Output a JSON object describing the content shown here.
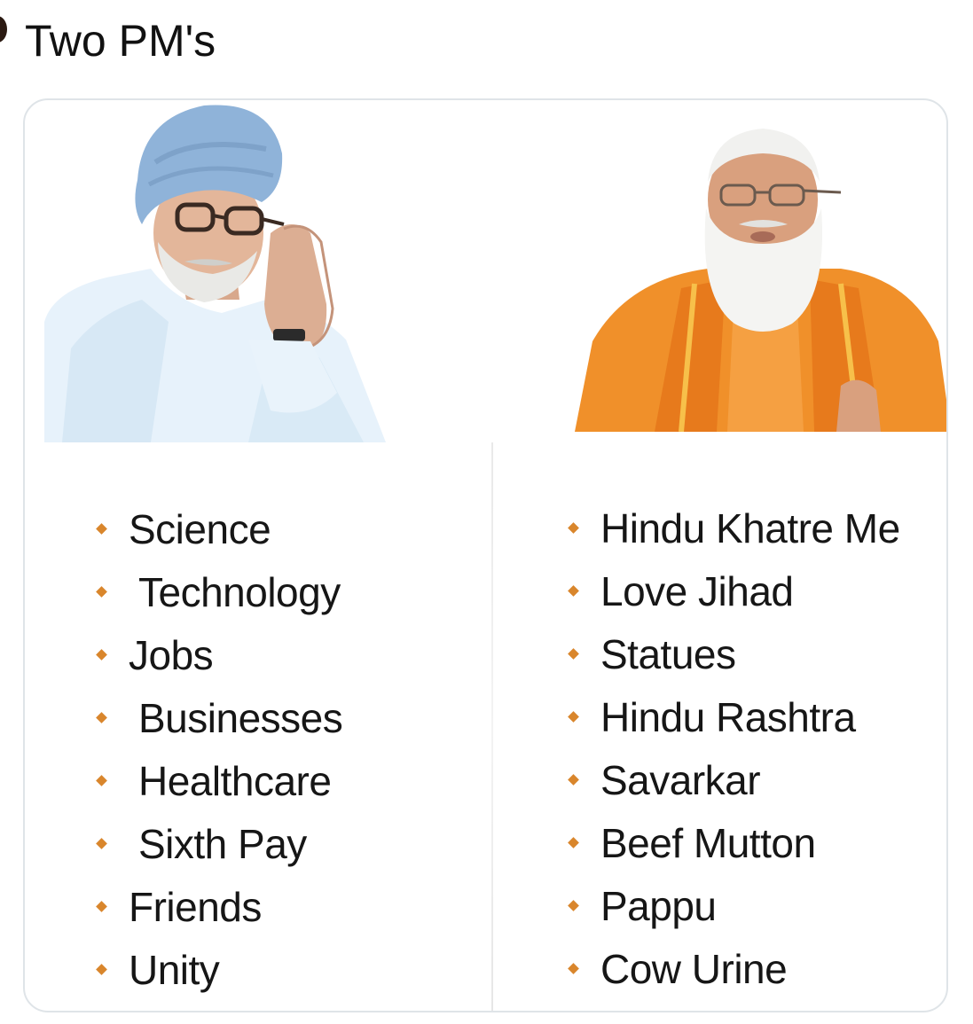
{
  "tweet": {
    "text": "Two PM's"
  },
  "colors": {
    "bullet": "#d9862c",
    "card_border": "#dfe4e8",
    "turban": "#8fb3d9",
    "saffron": "#f0902a"
  },
  "left_column": {
    "items": [
      {
        "label": "Science",
        "indent": false
      },
      {
        "label": "Technology",
        "indent": true
      },
      {
        "label": "Jobs",
        "indent": false
      },
      {
        "label": "Businesses",
        "indent": true
      },
      {
        "label": "Healthcare",
        "indent": true
      },
      {
        "label": "Sixth Pay",
        "indent": true
      },
      {
        "label": "Friends",
        "indent": false
      },
      {
        "label": "Unity",
        "indent": false
      }
    ]
  },
  "right_column": {
    "items": [
      {
        "label": "Hindu Khatre Me"
      },
      {
        "label": "Love Jihad"
      },
      {
        "label": "Statues"
      },
      {
        "label": "Hindu Rashtra"
      },
      {
        "label": "Savarkar"
      },
      {
        "label": "Beef Mutton"
      },
      {
        "label": "Pappu"
      },
      {
        "label": "Cow Urine"
      }
    ]
  }
}
